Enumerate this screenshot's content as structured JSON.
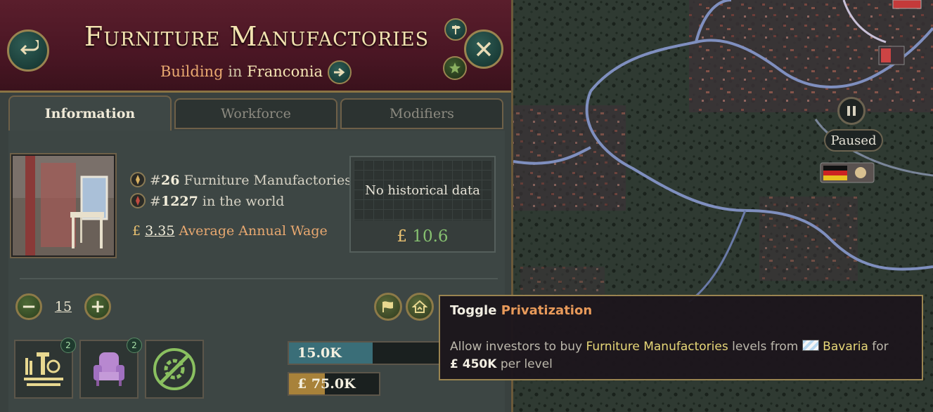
{
  "header": {
    "title": "Furniture Manufactories",
    "subtitle_type": "Building",
    "subtitle_in": "in",
    "subtitle_state": "Franconia"
  },
  "tabs": [
    {
      "label": "Information",
      "active": true
    },
    {
      "label": "Workforce",
      "active": false
    },
    {
      "label": "Modifiers",
      "active": false
    }
  ],
  "info": {
    "rank_country_prefix": "#",
    "rank_country": "26",
    "rank_country_label": "Furniture Manufactories",
    "rank_world_prefix": "#",
    "rank_world": "1227",
    "rank_world_label": "in the world",
    "currency": "£",
    "wage": "3.35",
    "wage_label": "Average Annual Wage"
  },
  "history": {
    "empty_text": "No historical data",
    "currency": "£",
    "value": "10.6"
  },
  "level": {
    "minus": "−",
    "value": "15",
    "plus": "+"
  },
  "production_methods": [
    {
      "icon": "machinery-icon",
      "badge": "2"
    },
    {
      "icon": "armchair-icon",
      "badge": "2"
    },
    {
      "icon": "no-automation-icon",
      "badge": ""
    }
  ],
  "bars": [
    {
      "label": "15.0K",
      "fill": 0.55,
      "color": "#3a6e78"
    },
    {
      "label": "£ 75.0K",
      "fill": 0.4,
      "color": "#a8823a"
    }
  ],
  "tooltip": {
    "title_prefix": "Toggle",
    "title_highlight": "Privatization",
    "body_1": "Allow investors to buy",
    "building": "Furniture Manufactories",
    "body_2": "levels from",
    "country": "Bavaria",
    "body_3": "for",
    "amount": "£ 450K",
    "body_4": "per level"
  },
  "map": {
    "paused_label": "Paused"
  },
  "colors": {
    "header_bg": "#5a1e2c",
    "gold": "#9a8450",
    "accent_orange": "#e8a870",
    "positive_green": "#86c070"
  }
}
